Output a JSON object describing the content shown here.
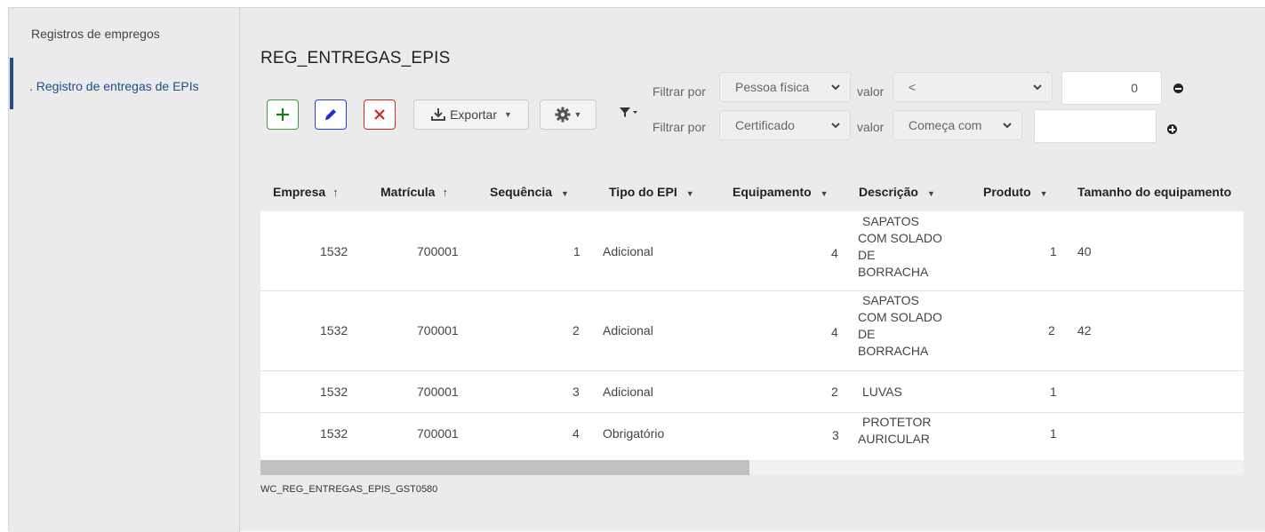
{
  "sidebar": {
    "items": [
      {
        "label": "Registros de empregos"
      },
      {
        "label": ". Registro de entregas de EPIs"
      }
    ]
  },
  "page": {
    "title": "REG_ENTREGAS_EPIS",
    "footer_code": "WC_REG_ENTREGAS_EPIS_GST0580"
  },
  "toolbar": {
    "export_label": "Exportar"
  },
  "filters": [
    {
      "label": "Filtrar por",
      "field": "Pessoa física",
      "value_label": "valor",
      "operator": "<",
      "value": "0"
    },
    {
      "label": "Filtrar por",
      "field": "Certificado",
      "value_label": "valor",
      "operator": "Começa com",
      "value": ""
    }
  ],
  "table": {
    "columns": [
      {
        "label": "Empresa",
        "sort": "↑"
      },
      {
        "label": "Matrícula",
        "sort": "↑"
      },
      {
        "label": "Sequência"
      },
      {
        "label": "Tipo do EPI"
      },
      {
        "label": "Equipamento"
      },
      {
        "label": "Descrição"
      },
      {
        "label": "Produto"
      },
      {
        "label": "Tamanho do equipamento"
      }
    ],
    "rows": [
      {
        "empresa": "1532",
        "matricula": "700001",
        "sequencia": "1",
        "tipo": "Adicional",
        "equipamento": "4",
        "descricao": [
          "SAPATOS",
          "COM SOLADO",
          "DE",
          "BORRACHA"
        ],
        "produto": "1",
        "tamanho": "40"
      },
      {
        "empresa": "1532",
        "matricula": "700001",
        "sequencia": "2",
        "tipo": "Adicional",
        "equipamento": "4",
        "descricao": [
          "SAPATOS",
          "COM SOLADO",
          "DE",
          "BORRACHA"
        ],
        "produto": "2",
        "tamanho": "42"
      },
      {
        "empresa": "1532",
        "matricula": "700001",
        "sequencia": "3",
        "tipo": "Adicional",
        "equipamento": "2",
        "descricao": [
          "LUVAS"
        ],
        "produto": "1",
        "tamanho": ""
      },
      {
        "empresa": "1532",
        "matricula": "700001",
        "sequencia": "4",
        "tipo": "Obrigatório",
        "equipamento": "3",
        "descricao": [
          "PROTETOR",
          "AURICULAR"
        ],
        "produto": "1",
        "tamanho": ""
      }
    ]
  }
}
